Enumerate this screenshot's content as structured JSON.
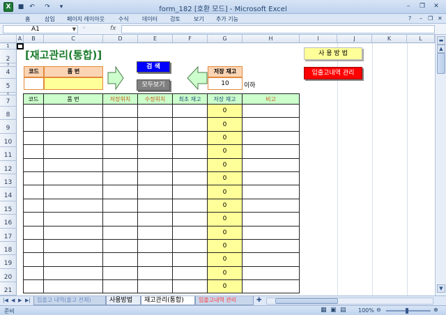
{
  "window": {
    "title": "form_182  [호환 모드] - Microsoft Excel",
    "app_icon": "X"
  },
  "ribbon": {
    "tabs": [
      "홈",
      "삽입",
      "페이지 레이아웃",
      "수식",
      "데이터",
      "검토",
      "보기",
      "추가 기능"
    ]
  },
  "formula_bar": {
    "cell_ref": "A1",
    "fx": "fx",
    "value": ""
  },
  "columns": [
    "A",
    "B",
    "C",
    "D",
    "E",
    "F",
    "G",
    "H",
    "I",
    "J",
    "K",
    "L"
  ],
  "rows": [
    "1",
    "2",
    "3",
    "4",
    "5",
    "6",
    "7",
    "8",
    "9",
    "10",
    "11",
    "12",
    "13",
    "14",
    "15",
    "16",
    "17",
    "18",
    "19",
    "20",
    "21"
  ],
  "sheet": {
    "title": "[재고관리(통합)]",
    "search_form": {
      "code_label": "코드",
      "item_label": "품        번",
      "code_value": "",
      "item_value": ""
    },
    "buttons": {
      "search": "검  색",
      "show_all": "모두보기",
      "usage": "사 용 방 법",
      "io_manage": "입출고내역 관리"
    },
    "threshold": {
      "label": "저장 재고",
      "value": "10",
      "suffix": "이하"
    },
    "table": {
      "headers": [
        "코드",
        "품      번",
        "저장위치",
        "수정위치",
        "최초 재고",
        "저장 재고",
        "비고"
      ],
      "stock_values": [
        "0",
        "0",
        "0",
        "0",
        "0",
        "0",
        "0",
        "0",
        "0",
        "0",
        "0",
        "0",
        "0",
        "0"
      ]
    }
  },
  "sheet_tabs": [
    "입출고 내역(출고 전체)",
    "사용방법",
    "재고관리(통합)",
    "입출고내역 관리"
  ],
  "active_sheet": "재고관리(통합)",
  "status": {
    "left": "준비",
    "zoom": "100%"
  },
  "colors": {
    "title_green": "#1b7b2c",
    "header_orange": "#fbd4b4",
    "table_header_green": "#ccffcc",
    "highlight_yellow": "#ffff99",
    "search_button_blue": "#0000ff",
    "io_button_red": "#ff0000"
  }
}
